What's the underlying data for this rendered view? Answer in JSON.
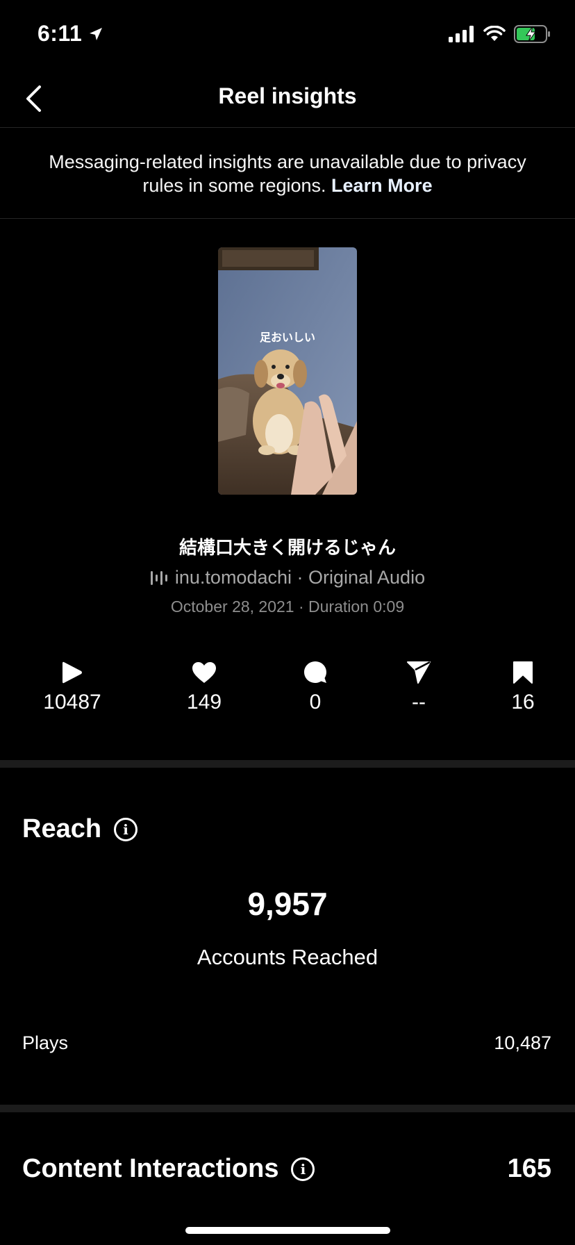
{
  "status_bar": {
    "time": "6:11"
  },
  "nav": {
    "title": "Reel insights"
  },
  "notice": {
    "text": "Messaging-related insights are unavailable due to privacy rules in some regions.",
    "link": "Learn More"
  },
  "thumbnail": {
    "caption": "足おいしい"
  },
  "reel": {
    "title": "結構口大きく開けるじゃん",
    "audio": "inu.tomodachi · Original Audio",
    "meta": "October 28, 2021 · Duration 0:09"
  },
  "metrics": {
    "plays": "10487",
    "likes": "149",
    "comments": "0",
    "shares": "--",
    "saves": "16"
  },
  "reach": {
    "title": "Reach",
    "accounts_reached_value": "9,957",
    "accounts_reached_label": "Accounts Reached",
    "plays_label": "Plays",
    "plays_value": "10,487"
  },
  "content_interactions": {
    "title": "Content Interactions",
    "value": "165"
  }
}
